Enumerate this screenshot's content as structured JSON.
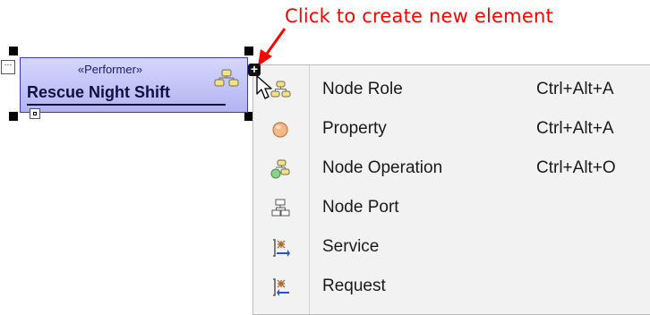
{
  "callout": {
    "text": "Click to create new element",
    "color": "#ff0000"
  },
  "element": {
    "stereotype": "«Performer»",
    "name": "Rescue Night Shift",
    "icon": "node-role-icon",
    "fill": "#c4c4f8",
    "border": "#3a3aa8"
  },
  "menu": {
    "items": [
      {
        "label": "Node Role",
        "shortcut": "Ctrl+Alt+A",
        "icon": "node-role-icon"
      },
      {
        "label": "Property",
        "shortcut": "Ctrl+Alt+A",
        "icon": "property-icon"
      },
      {
        "label": "Node Operation",
        "shortcut": "Ctrl+Alt+O",
        "icon": "node-operation-icon"
      },
      {
        "label": "Node Port",
        "shortcut": "",
        "icon": "node-port-icon"
      },
      {
        "label": "Service",
        "shortcut": "",
        "icon": "service-icon"
      },
      {
        "label": "Request",
        "shortcut": "",
        "icon": "request-icon"
      }
    ]
  }
}
